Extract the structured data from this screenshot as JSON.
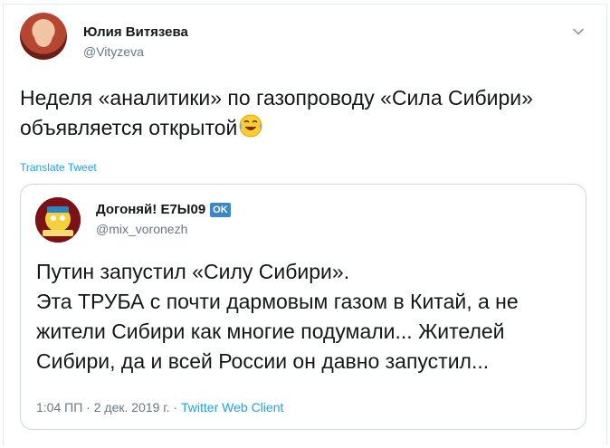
{
  "tweet": {
    "author_name": "Юлия Витязева",
    "author_handle": "@Vityzeva",
    "text": "Неделя «аналитики» по газопроводу «Сила Сибири» объявляется открытой",
    "emoji": "face-with-tears-of-joy-emoji",
    "translate_label": "Translate Tweet",
    "menu_icon": "chevron-down-icon"
  },
  "quoted_tweet": {
    "author_name": "Догоняй! Е7Ы09",
    "badge": "OK",
    "author_handle": "@mix_voronezh",
    "lines": [
      "Путин запустил «Силу Сибири».",
      "Эта ТРУБА с почти дармовым газом в Китай, а не",
      "жители Сибири как многие подумали... Жителей",
      "Сибири, да и всей России он давно запустил..."
    ],
    "time": "1:04 ПП",
    "separator": "·",
    "date": "2 дек. 2019 г.",
    "client": "Twitter Web Client"
  },
  "colors": {
    "accent": "#1da1f2",
    "secondary_text": "#657786",
    "border": "#ccd6dd"
  }
}
